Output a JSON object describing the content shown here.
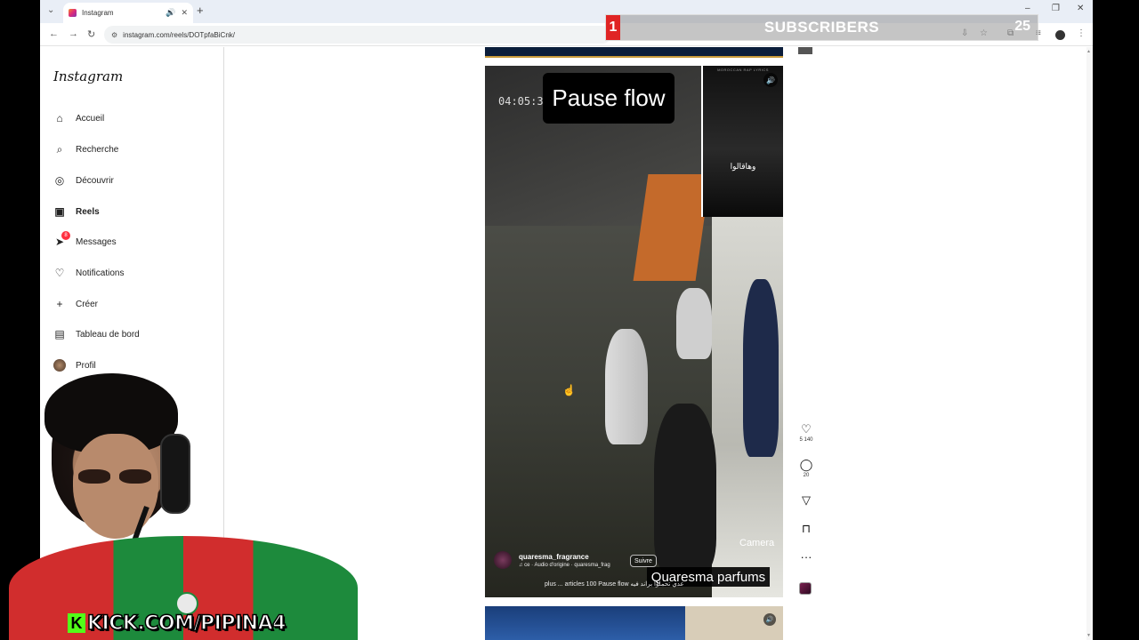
{
  "browser": {
    "tab_title": "Instagram",
    "url": "instagram.com/reels/DOTpfaBiCnk/"
  },
  "sidebar": {
    "logo": "Instagram",
    "items": [
      {
        "label": "Accueil",
        "icon": "home-icon"
      },
      {
        "label": "Recherche",
        "icon": "search-icon"
      },
      {
        "label": "Découvrir",
        "icon": "compass-icon"
      },
      {
        "label": "Reels",
        "icon": "reels-icon",
        "active": true
      },
      {
        "label": "Messages",
        "icon": "messenger-icon",
        "badge": "8"
      },
      {
        "label": "Notifications",
        "icon": "heart-icon"
      },
      {
        "label": "Créer",
        "icon": "plus-icon"
      },
      {
        "label": "Tableau de bord",
        "icon": "dashboard-icon"
      },
      {
        "label": "Profil",
        "icon": "profile-avatar"
      }
    ]
  },
  "reel": {
    "timestamp": "04:05:35",
    "title_overlay": "Pause flow",
    "clip_text": "وهاقالوا",
    "clip_header": "MOROCCAN RAP LYRICS",
    "camera_label": "Camera",
    "username": "quaresma_fragrance",
    "audio": "ce · Audio d'origine · quaresma_frag",
    "follow_label": "Suivre",
    "caption": "plus ... articles 100 Pause flow عدي تحملوا براند فيه",
    "brand_label": "Quaresma parfums"
  },
  "actions": {
    "likes": "5 140",
    "comments": "20"
  },
  "overlays": {
    "subscribers_label": "SUBSCRIBERS",
    "subscribers_current": "1",
    "subscribers_goal": "25",
    "kick_url": "KICK.COM/PIPINA4",
    "kick_logo": "K"
  },
  "colors": {
    "kick_green": "#53fc18",
    "sub_red": "#e02424",
    "ig_badge": "#ff3040"
  }
}
